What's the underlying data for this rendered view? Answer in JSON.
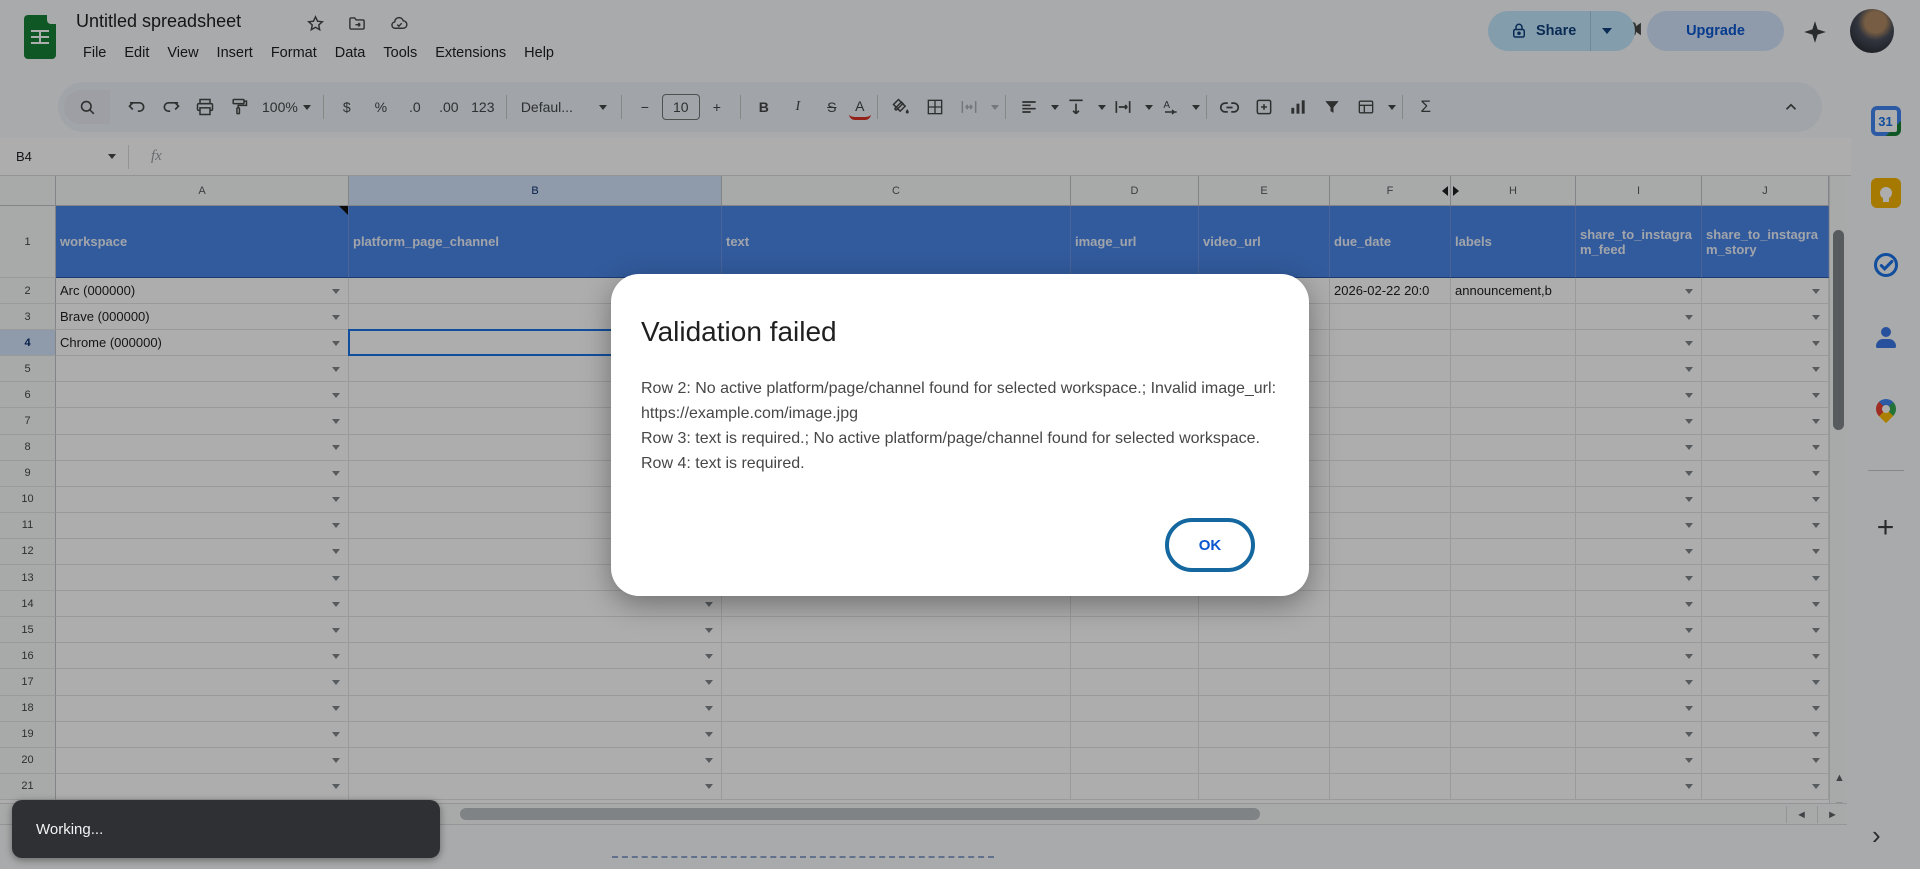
{
  "titlebar": {
    "title": "Untitled spreadsheet",
    "menus": [
      "File",
      "Edit",
      "View",
      "Insert",
      "Format",
      "Data",
      "Tools",
      "Extensions",
      "Help"
    ],
    "share_label": "Share",
    "upgrade_label": "Upgrade"
  },
  "toolbar": {
    "zoom": "100%",
    "currency": "$",
    "percent": "%",
    "decimal_decrease": ".0",
    "decimal_increase": ".00",
    "more_formats": "123",
    "font_name": "Defaul...",
    "minus": "−",
    "font_size": "10",
    "plus": "+",
    "bold": "B",
    "italic": "I",
    "strikethrough": "S",
    "text_color": "A",
    "functions": "Σ"
  },
  "formula_bar": {
    "name_box": "B4",
    "fx_label": "fx"
  },
  "grid": {
    "columns": [
      {
        "letter": "A",
        "header": "workspace"
      },
      {
        "letter": "B",
        "header": "platform_page_channel"
      },
      {
        "letter": "C",
        "header": "text"
      },
      {
        "letter": "D",
        "header": "image_url"
      },
      {
        "letter": "E",
        "header": "video_url"
      },
      {
        "letter": "F",
        "header": "due_date"
      },
      {
        "letter": "H",
        "header": "labels"
      },
      {
        "letter": "I",
        "header": "share_to_instagram_feed"
      },
      {
        "letter": "J",
        "header": "share_to_instagram_story"
      }
    ],
    "hidden_column_between": [
      "F",
      "H"
    ],
    "dropdown_columns": [
      "A",
      "B",
      "I",
      "J"
    ],
    "cells": {
      "A2": "Arc (000000)",
      "A3": "Brave (000000)",
      "A4": "Chrome (000000)",
      "F2": "2026-02-22 20:0",
      "H2": "announcement,b"
    },
    "first_row": 2,
    "last_row": 21,
    "selection": {
      "cell": "B4",
      "row": 4,
      "column": "B"
    }
  },
  "dialog": {
    "title": "Validation failed",
    "lines": [
      "Row 2: No active platform/page/channel found for selected workspace.; Invalid image_url: https://example.com/image.jpg",
      "Row 3: text is required.; No active platform/page/channel found for selected workspace.",
      "Row 4: text is required."
    ],
    "ok_label": "OK"
  },
  "toast": {
    "message": "Working..."
  },
  "side_panel": {
    "calendar_label": "31"
  },
  "colors": {
    "header_fill": "#4a86e8",
    "selection_border": "#1a73e8",
    "selected_header_bg": "#d3e3fd",
    "share_bg": "#c2e7ff",
    "upgrade_bg": "#d3e3fd",
    "ok_ring": "#15679f",
    "ok_text": "#0b57d0",
    "toast_bg": "#2e3033",
    "scrim": "rgba(0,0,0,0.32)"
  }
}
